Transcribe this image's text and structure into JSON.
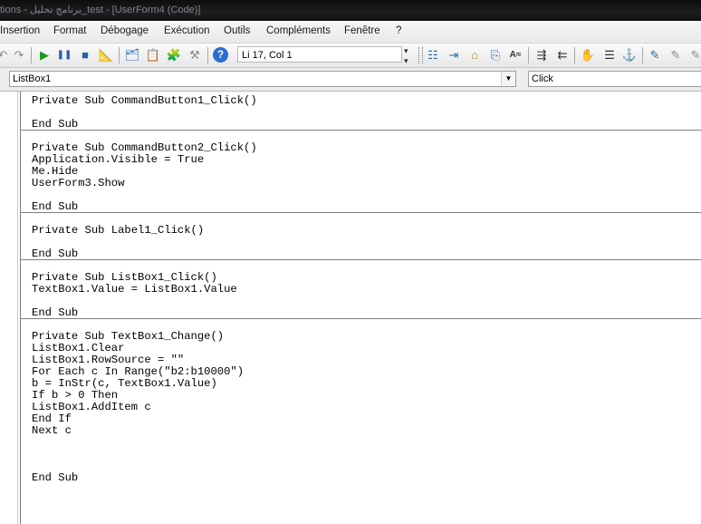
{
  "window": {
    "title": "tions - برنامج تحليل_test - [UserForm4 (Code)]"
  },
  "menu": [
    "Insertion",
    "Format",
    "Débogage",
    "Exécution",
    "Outils",
    "Compléments",
    "Fenêtre",
    "?"
  ],
  "toolbar": {
    "position": "Li 17, Col 1",
    "icons": [
      "undo-icon",
      "redo-icon",
      "run-icon",
      "pause-icon",
      "stop-icon",
      "design-mode-icon",
      "project-explorer-icon",
      "properties-icon",
      "object-browser-icon",
      "toolbox-icon",
      "help-icon",
      "list-properties-icon",
      "list-constants-icon",
      "quick-info-icon",
      "parameter-info-icon",
      "complete-word-icon",
      "indent-icon",
      "outdent-icon",
      "toggle-breakpoint-icon",
      "comment-block-icon",
      "uncomment-block-icon",
      "toggle-bookmark-icon",
      "next-bookmark-icon"
    ]
  },
  "object_combo": "ListBox1",
  "procedure_combo": "Click",
  "code": [
    {
      "lines": [
        "Private Sub CommandButton1_Click()",
        "",
        "End Sub"
      ]
    },
    {
      "lines": [
        "Private Sub CommandButton2_Click()",
        "Application.Visible = True",
        "Me.Hide",
        "UserForm3.Show",
        "",
        "End Sub"
      ]
    },
    {
      "lines": [
        "Private Sub Label1_Click()",
        "",
        "End Sub"
      ]
    },
    {
      "lines": [
        "Private Sub ListBox1_Click()",
        "TextBox1.Value = ListBox1.Value",
        "",
        "End Sub"
      ]
    },
    {
      "lines": [
        "Private Sub TextBox1_Change()",
        "ListBox1.Clear",
        "ListBox1.RowSource = \"\"",
        "For Each c In Range(\"b2:b10000\")",
        "b = InStr(c, TextBox1.Value)",
        "If b > 0 Then",
        "ListBox1.AddItem c",
        "End If",
        "Next c",
        "",
        "",
        "",
        "End Sub"
      ]
    }
  ]
}
